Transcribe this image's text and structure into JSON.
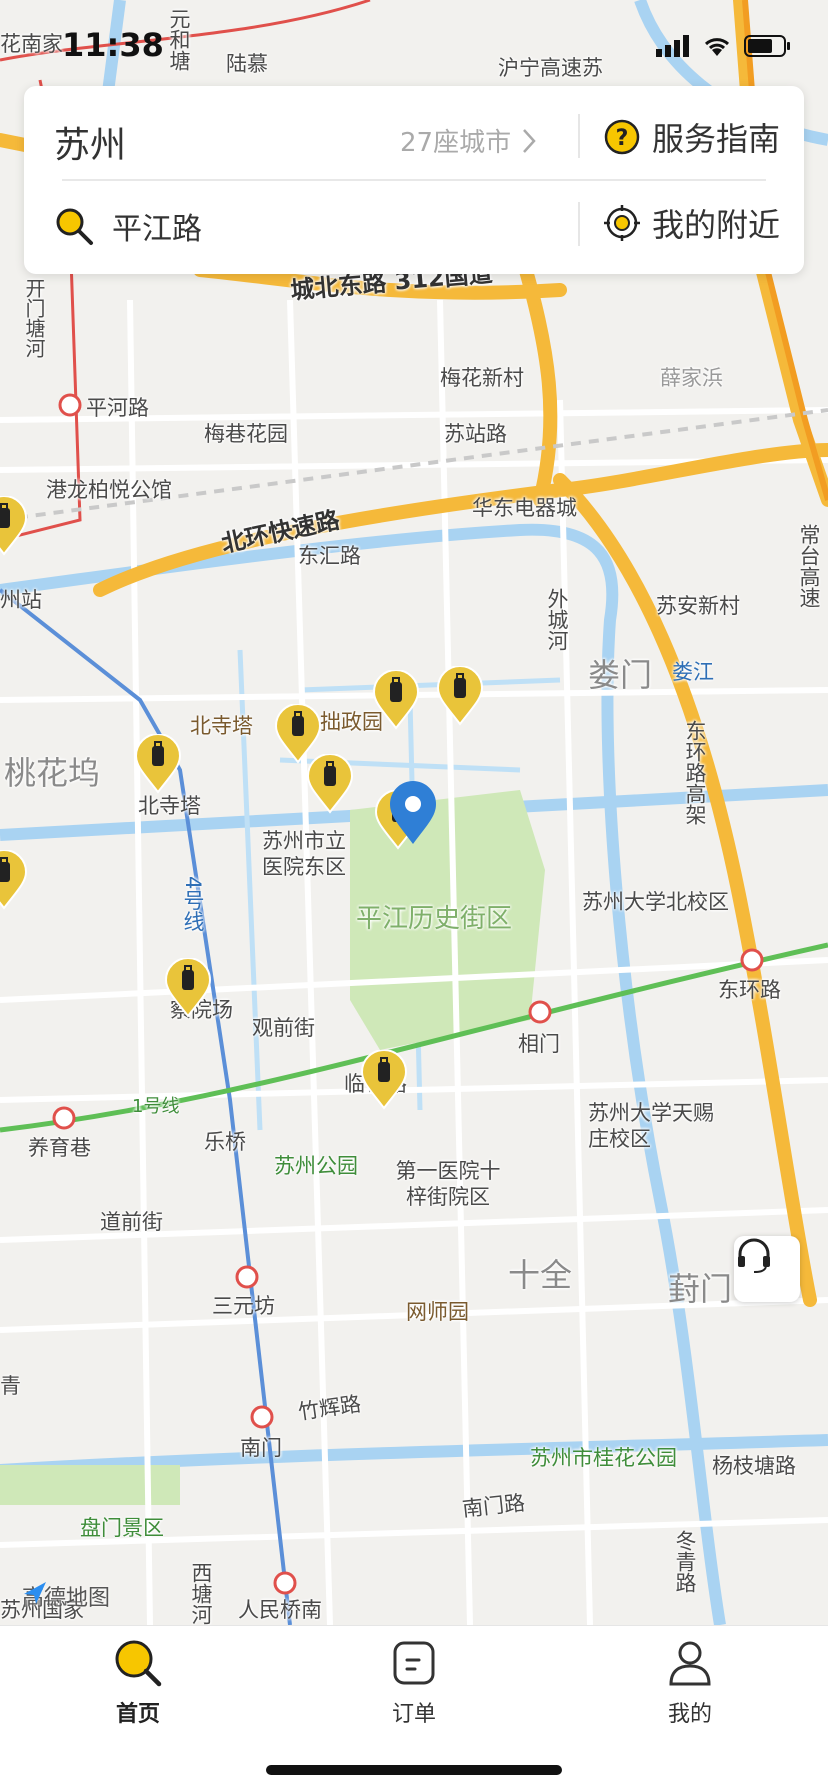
{
  "status_bar": {
    "time": "11:38"
  },
  "header": {
    "city": "苏州",
    "city_count": "27座城市",
    "guide_label": "服务指南",
    "search_value": "平江路",
    "nearby_label": "我的附近"
  },
  "map": {
    "labels": {
      "huanan": "花南家",
      "yuanhetang": "元和塘",
      "lumu": "陆慕",
      "hunings": "沪宁高速苏",
      "national": "城北东路 312国道",
      "kaimentang": "开门塘河",
      "meihua": "梅花新村",
      "xuejiabang": "薛家浜",
      "pinghelu": "平河路",
      "meixiang": "梅巷花园",
      "suzhan": "苏站路",
      "ganglong": "港龙柏悦公馆",
      "huadong": "华东电器城",
      "beihuan": "北环快速路",
      "donghui": "东汇路",
      "changtai": "常台高速",
      "zhouzhan": "州站",
      "waicheng": "外城河",
      "suan": "苏安新村",
      "loumen": "娄门",
      "loujiang": "娄江",
      "zhuozheng": "拙政园",
      "beisita_poi": "北寺塔",
      "taohuawu": "桃花坞",
      "beisita_st": "北寺塔",
      "huanlu": "东环路高架",
      "hospital": "苏州市立医院东区",
      "pingjiang": "平江历史街区",
      "suda_north": "苏州大学北校区",
      "line4": "4号线",
      "chayuan": "察院场",
      "guanqian": "观前街",
      "xiangmen": "相门",
      "donghuanlu": "东环路",
      "linton": "临顿路",
      "line1": "1号线",
      "yangyu": "养育巷",
      "leqiao": "乐桥",
      "suzhoupark": "苏州公园",
      "firsthosp": "第一医院十梓街院区",
      "suda_tianci": "苏州大学天赐庄校区",
      "daoqian": "道前街",
      "shiquan": "十全",
      "fengmen": "葑门",
      "sanyuanfang": "三元坊",
      "wangshi": "网师园",
      "zhuhui": "竹辉路",
      "nanmen": "南门",
      "guihua": "苏州市桂花公园",
      "yangzhi": "杨枝塘路",
      "panmen": "盘门景区",
      "nanmenlu": "南门路",
      "dongqing": "冬青路",
      "xitang": "西塘河",
      "renmin": "人民桥南",
      "suzhouguojia": "苏州国家",
      "jiangnan": "青"
    },
    "attribution": "高德地图"
  },
  "tabs": [
    {
      "label": "首页",
      "icon": "search-icon"
    },
    {
      "label": "订单",
      "icon": "order-icon"
    },
    {
      "label": "我的",
      "icon": "user-icon"
    }
  ],
  "colors": {
    "accent": "#f7c600",
    "marker": "#e9c43a",
    "location": "#2f7fd6",
    "highway": "#f5b93a"
  }
}
